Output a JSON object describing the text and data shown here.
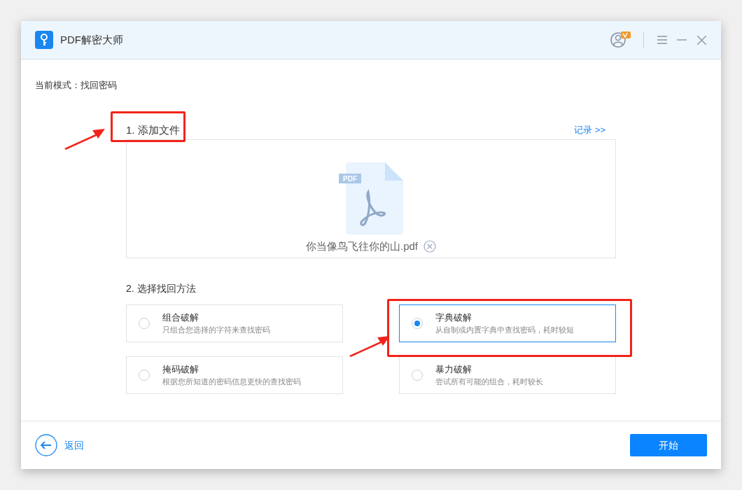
{
  "window": {
    "title": "PDF解密大师"
  },
  "mode": {
    "label": "当前模式：找回密码"
  },
  "step1": {
    "heading": "1. 添加文件",
    "history_link": "记录 >>",
    "file": {
      "badge": "PDF",
      "name": "你当像鸟飞往你的山.pdf"
    }
  },
  "step2": {
    "heading": "2. 选择找回方法",
    "options": [
      {
        "title": "组合破解",
        "description": "只组合您选择的字符来查找密码",
        "selected": false
      },
      {
        "title": "字典破解",
        "description": "从自制或内置字典中查找密码，耗时较短",
        "selected": true
      },
      {
        "title": "掩码破解",
        "description": "根据您所知道的密码信息更快的查找密码",
        "selected": false
      },
      {
        "title": "暴力破解",
        "description": "尝试所有可能的组合，耗时较长",
        "selected": false
      }
    ]
  },
  "footer": {
    "back": "返回",
    "start": "开始"
  }
}
